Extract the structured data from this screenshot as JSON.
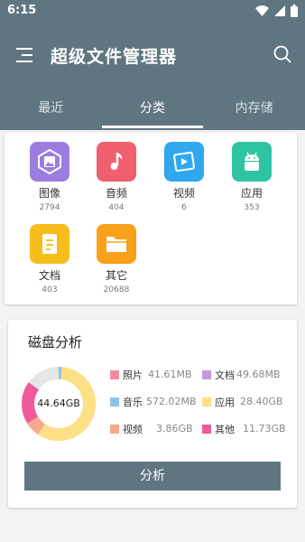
{
  "status_bar": {
    "time": "6:15"
  },
  "app_bar": {
    "title": "超级文件管理器"
  },
  "tabs": [
    {
      "label": "最近",
      "active": false
    },
    {
      "label": "分类",
      "active": true
    },
    {
      "label": "内存储",
      "active": false
    }
  ],
  "categories": [
    {
      "name": "图像",
      "count": "2794",
      "color": "#9b7de0",
      "icon": "image-icon"
    },
    {
      "name": "音频",
      "count": "404",
      "color": "#ef5f6e",
      "icon": "music-note-icon"
    },
    {
      "name": "视频",
      "count": "6",
      "color": "#2fa8ee",
      "icon": "video-icon"
    },
    {
      "name": "应用",
      "count": "353",
      "color": "#2ec4a2",
      "icon": "android-icon"
    },
    {
      "name": "文档",
      "count": "403",
      "color": "#f7bd1b",
      "icon": "document-icon"
    },
    {
      "name": "其它",
      "count": "20688",
      "color": "#f9a11b",
      "icon": "folder-icon"
    }
  ],
  "disk_analysis": {
    "title": "磁盘分析",
    "total": "44.64GB",
    "button_label": "分析",
    "legend": [
      {
        "name": "照片",
        "value": "41.61MB",
        "color": "#f08ca2"
      },
      {
        "name": "文档",
        "value": "49.68MB",
        "color": "#c997db"
      },
      {
        "name": "音乐",
        "value": "572.02MB",
        "color": "#8fc2e8"
      },
      {
        "name": "应用",
        "value": "28.40GB",
        "color": "#fddf86"
      },
      {
        "name": "视频",
        "value": "3.86GB",
        "color": "#f7a98c"
      },
      {
        "name": "其他",
        "value": "11.73GB",
        "color": "#f05a9a"
      }
    ],
    "free_color": "#e6e6e6"
  }
}
